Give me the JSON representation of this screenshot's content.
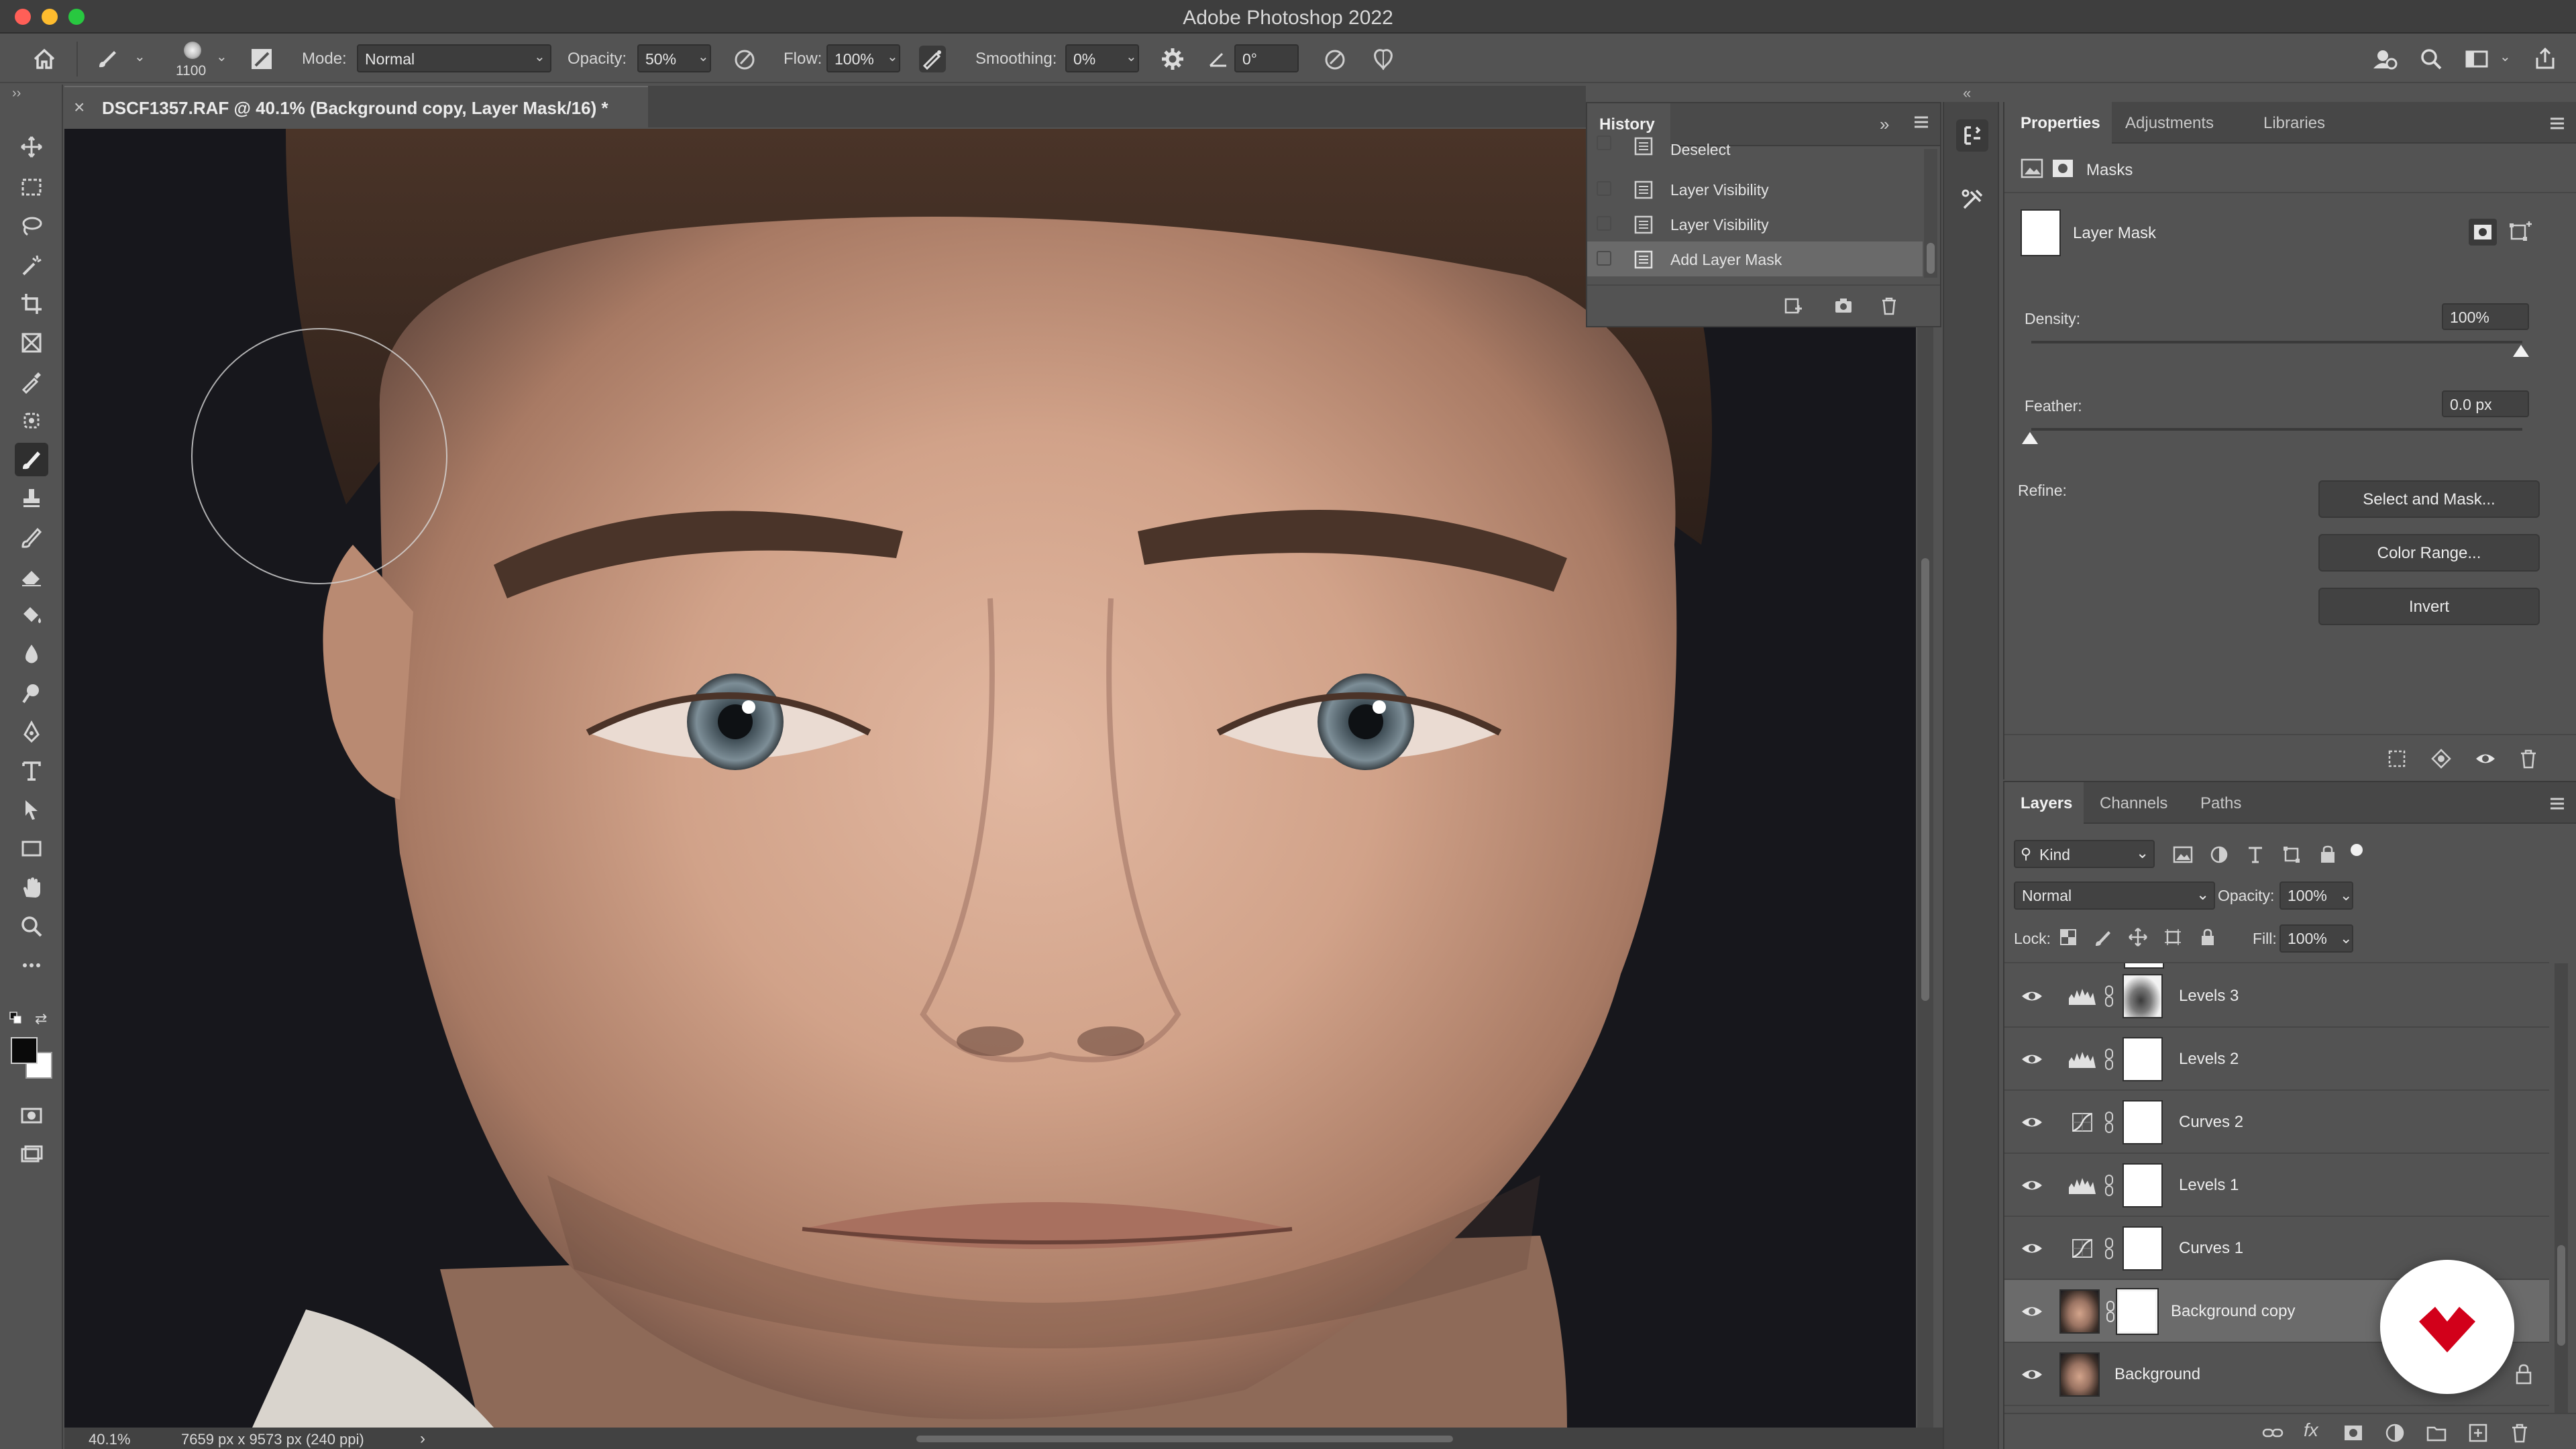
{
  "window": {
    "title": "Adobe Photoshop 2022",
    "traffic_lights": {
      "close": "#ff5f57",
      "minimize": "#febc2e",
      "maximize": "#28c840"
    }
  },
  "options_bar": {
    "brush_size": "1100",
    "mode_label": "Mode:",
    "mode_value": "Normal",
    "opacity_label": "Opacity:",
    "opacity_value": "50%",
    "flow_label": "Flow:",
    "flow_value": "100%",
    "smoothing_label": "Smoothing:",
    "smoothing_value": "0%",
    "angle_value": "0°"
  },
  "document": {
    "tab_title": "DSCF1357.RAF @ 40.1% (Background copy, Layer Mask/16) *",
    "zoom": "40.1%",
    "dimensions": "7659 px x 9573 px (240 ppi)"
  },
  "history": {
    "tab": "History",
    "items": [
      {
        "label": "Deselect"
      },
      {
        "label": "Layer Visibility"
      },
      {
        "label": "Layer Visibility"
      },
      {
        "label": "Add Layer Mask",
        "selected": true
      }
    ]
  },
  "properties": {
    "tabs": [
      "Properties",
      "Adjustments",
      "Libraries"
    ],
    "section": "Masks",
    "mask_name": "Layer Mask",
    "density_label": "Density:",
    "density_value": "100%",
    "feather_label": "Feather:",
    "feather_value": "0.0 px",
    "refine_label": "Refine:",
    "buttons": [
      "Select and Mask...",
      "Color Range...",
      "Invert"
    ]
  },
  "layers": {
    "tabs": [
      "Layers",
      "Channels",
      "Paths"
    ],
    "kind_label": "Kind",
    "blend_mode": "Normal",
    "opacity_label": "Opacity:",
    "opacity_value": "100%",
    "lock_label": "Lock:",
    "fill_label": "Fill:",
    "fill_value": "100%",
    "items": [
      {
        "name": "Levels 3",
        "type": "levels",
        "mask": "dark"
      },
      {
        "name": "Levels 2",
        "type": "levels",
        "mask": "white"
      },
      {
        "name": "Curves 2",
        "type": "curves",
        "mask": "white"
      },
      {
        "name": "Levels 1",
        "type": "levels",
        "mask": "white"
      },
      {
        "name": "Curves 1",
        "type": "curves",
        "mask": "white"
      },
      {
        "name": "Background copy",
        "type": "photo",
        "mask": "white",
        "selected": true
      },
      {
        "name": "Background",
        "type": "photo",
        "locked": true
      }
    ]
  },
  "colors": {
    "accent": "#d2001a",
    "panel_bg": "#535353",
    "selected_row": "#6b6b6b"
  }
}
